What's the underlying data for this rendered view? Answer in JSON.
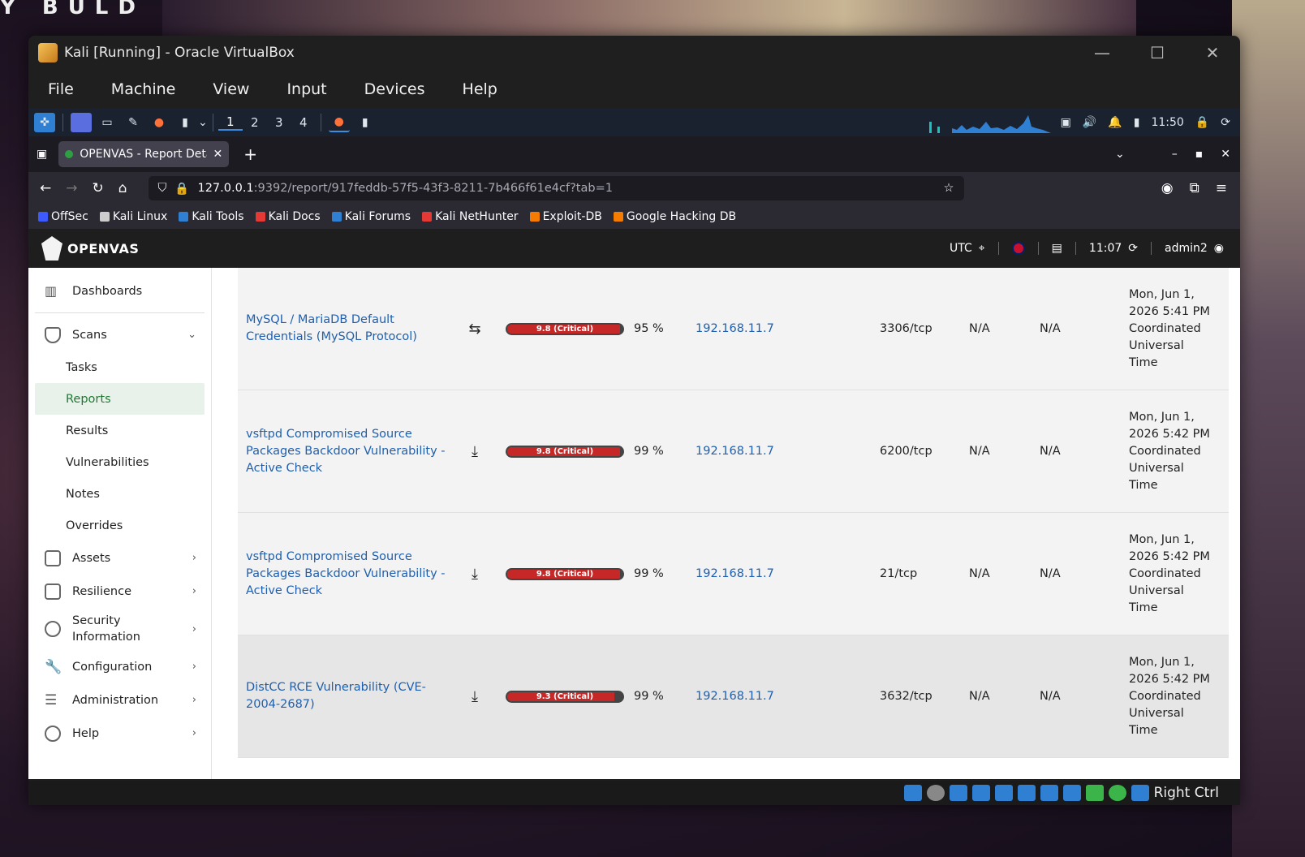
{
  "desktop": {
    "watermark": "Y BULD"
  },
  "window": {
    "title": "Kali [Running] - Oracle VirtualBox",
    "menu": [
      "File",
      "Machine",
      "View",
      "Input",
      "Devices",
      "Help"
    ],
    "controls": {
      "minimize": "—",
      "maximize": "☐",
      "close": "✕"
    }
  },
  "panel": {
    "workspaces": [
      "1",
      "2",
      "3",
      "4"
    ],
    "clock": "11:50"
  },
  "browser": {
    "tab_title": "OPENVAS - Report Details",
    "url_host": "127.0.0.1",
    "url_path": ":9392/report/917feddb-57f5-43f3-8211-7b466f61e4cf?tab=1",
    "bookmarks": [
      {
        "label": "OffSec",
        "color": "#3d5afe"
      },
      {
        "label": "Kali Linux",
        "color": "#cccccc"
      },
      {
        "label": "Kali Tools",
        "color": "#2f7fd3"
      },
      {
        "label": "Kali Docs",
        "color": "#e53935"
      },
      {
        "label": "Kali Forums",
        "color": "#2f7fd3"
      },
      {
        "label": "Kali NetHunter",
        "color": "#e53935"
      },
      {
        "label": "Exploit-DB",
        "color": "#f57c00"
      },
      {
        "label": "Google Hacking DB",
        "color": "#f57c00"
      }
    ]
  },
  "app": {
    "logo": "OPENVAS",
    "timezone": "UTC",
    "time": "11:07",
    "user": "admin2"
  },
  "sidebar": {
    "dashboards": "Dashboards",
    "scans": "Scans",
    "scan_items": [
      "Tasks",
      "Reports",
      "Results",
      "Vulnerabilities",
      "Notes",
      "Overrides"
    ],
    "assets": "Assets",
    "resilience": "Resilience",
    "security_information": "Security Information",
    "configuration": "Configuration",
    "administration": "Administration",
    "help": "Help"
  },
  "results": [
    {
      "name": "MySQL / MariaDB Default Credentials (MySQL Protocol)",
      "sev_icon": "⇆",
      "severity": 9.8,
      "severity_label": "9.8 (Critical)",
      "qod": "95 %",
      "host": "192.168.11.7",
      "location": "3306/tcp",
      "epss_score": "N/A",
      "epss_percentile": "N/A",
      "created": "Mon, Jun 1, 2026 5:41 PM Coordinated Universal Time"
    },
    {
      "name": "vsftpd Compromised Source Packages Backdoor Vulnerability - Active Check",
      "sev_icon": "⤓",
      "severity": 9.8,
      "severity_label": "9.8 (Critical)",
      "qod": "99 %",
      "host": "192.168.11.7",
      "location": "6200/tcp",
      "epss_score": "N/A",
      "epss_percentile": "N/A",
      "created": "Mon, Jun 1, 2026 5:42 PM Coordinated Universal Time"
    },
    {
      "name": "vsftpd Compromised Source Packages Backdoor Vulnerability - Active Check",
      "sev_icon": "⤓",
      "severity": 9.8,
      "severity_label": "9.8 (Critical)",
      "qod": "99 %",
      "host": "192.168.11.7",
      "location": "21/tcp",
      "epss_score": "N/A",
      "epss_percentile": "N/A",
      "created": "Mon, Jun 1, 2026 5:42 PM Coordinated Universal Time"
    },
    {
      "name": "DistCC RCE Vulnerability (CVE-2004-2687)",
      "sev_icon": "⤓",
      "severity": 9.3,
      "severity_label": "9.3 (Critical)",
      "qod": "99 %",
      "host": "192.168.11.7",
      "location": "3632/tcp",
      "epss_score": "N/A",
      "epss_percentile": "N/A",
      "created": "Mon, Jun 1, 2026 5:42 PM Coordinated Universal Time"
    }
  ],
  "statusbar": {
    "host_key": "Right Ctrl"
  }
}
